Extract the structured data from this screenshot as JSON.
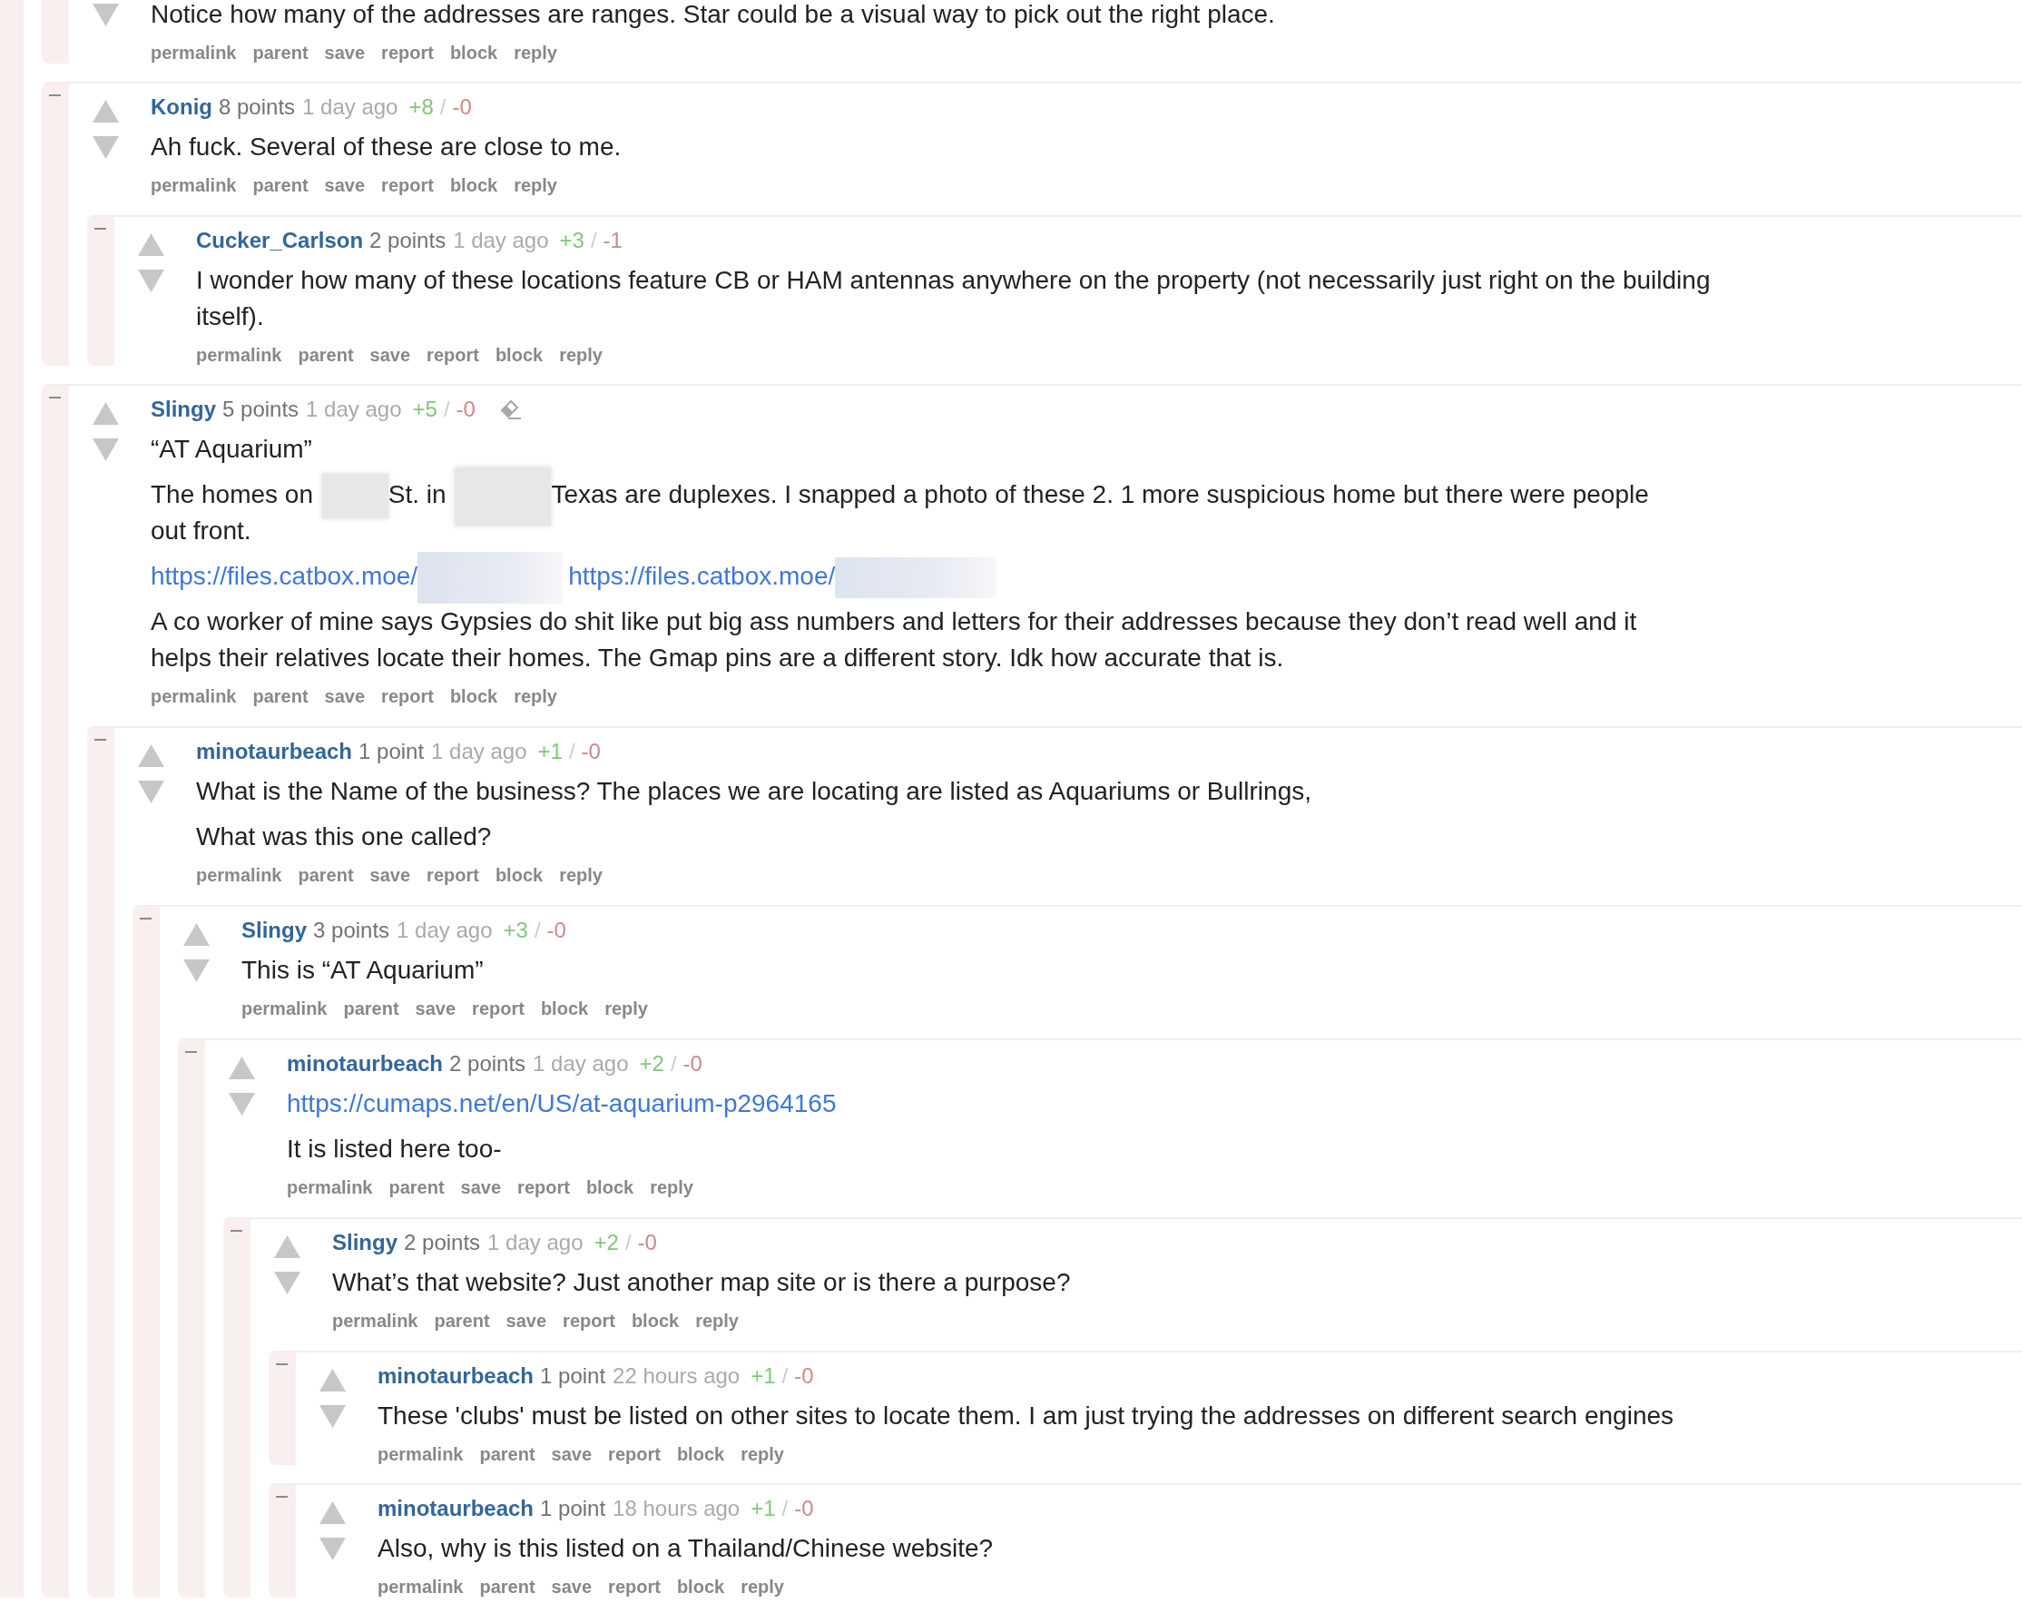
{
  "parent_comment": {
    "children": [
      {
        "body": [
          "Notice how many of the addresses are ranges. Star could be a visual way to pick out the right place."
        ],
        "actions": [
          "permalink",
          "parent",
          "save",
          "report",
          "block",
          "reply"
        ]
      },
      {
        "author": "Konig",
        "points": "8 points",
        "age": "1 day ago",
        "upvotes": "+8",
        "separator": "/",
        "downvotes": "-0",
        "edited": false,
        "body": [
          "Ah fuck. Several of these are close to me."
        ],
        "actions": [
          "permalink",
          "parent",
          "save",
          "report",
          "block",
          "reply"
        ],
        "children": [
          {
            "author": "Cucker_Carlson",
            "points": "2 points",
            "age": "1 day ago",
            "upvotes": "+3",
            "separator": "/",
            "downvotes": "-1",
            "edited": false,
            "body": [
              "I wonder how many of these locations feature CB or HAM antennas anywhere on the property (not necessarily just right on the building itself)."
            ],
            "actions": [
              "permalink",
              "parent",
              "save",
              "report",
              "block",
              "reply"
            ]
          }
        ]
      },
      {
        "author": "Slingy",
        "points": "5 points",
        "age": "1 day ago",
        "upvotes": "+5",
        "separator": "/",
        "downvotes": "-0",
        "edited": true,
        "body": [
          "“AT Aquarium”",
          [
            {
              "kind": "text",
              "text": "The homes on "
            },
            {
              "kind": "redacted"
            },
            {
              "kind": "text",
              "text": "St. in "
            },
            {
              "kind": "redacted"
            },
            {
              "kind": "text",
              "text": "Texas are duplexes. I snapped a photo of these 2. 1 more suspicious home but there were people out front."
            }
          ],
          [
            {
              "kind": "link",
              "text": "https://files.catbox.moe/"
            },
            {
              "kind": "redacted"
            },
            {
              "kind": "link",
              "text": "https://files.catbox.moe/"
            },
            {
              "kind": "redacted"
            }
          ],
          "A co worker of mine says Gypsies do shit like put big ass numbers and letters for their addresses because they don’t read well and it helps their relatives locate their homes. The Gmap pins are a different story. Idk how accurate that is."
        ],
        "actions": [
          "permalink",
          "parent",
          "save",
          "report",
          "block",
          "reply"
        ],
        "children": [
          {
            "author": "minotaurbeach",
            "points": "1 point",
            "age": "1 day ago",
            "upvotes": "+1",
            "separator": "/",
            "downvotes": "-0",
            "edited": false,
            "body": [
              "What is the Name of the business? The places we are locating are listed as Aquariums or Bullrings,",
              "What was this one called?"
            ],
            "actions": [
              "permalink",
              "parent",
              "save",
              "report",
              "block",
              "reply"
            ],
            "children": [
              {
                "author": "Slingy",
                "points": "3 points",
                "age": "1 day ago",
                "upvotes": "+3",
                "separator": "/",
                "downvotes": "-0",
                "edited": false,
                "body": [
                  "This is “AT Aquarium”"
                ],
                "actions": [
                  "permalink",
                  "parent",
                  "save",
                  "report",
                  "block",
                  "reply"
                ],
                "children": [
                  {
                    "author": "minotaurbeach",
                    "points": "2 points",
                    "age": "1 day ago",
                    "upvotes": "+2",
                    "separator": "/",
                    "downvotes": "-0",
                    "edited": false,
                    "body": [
                      [
                        {
                          "kind": "link",
                          "text": "https://cumaps.net/en/US/at-aquarium-p2964165"
                        }
                      ],
                      "It is listed here too-"
                    ],
                    "actions": [
                      "permalink",
                      "parent",
                      "save",
                      "report",
                      "block",
                      "reply"
                    ],
                    "children": [
                      {
                        "author": "Slingy",
                        "points": "2 points",
                        "age": "1 day ago",
                        "upvotes": "+2",
                        "separator": "/",
                        "downvotes": "-0",
                        "edited": false,
                        "body": [
                          "What’s that website? Just another map site or is there a purpose?"
                        ],
                        "actions": [
                          "permalink",
                          "parent",
                          "save",
                          "report",
                          "block",
                          "reply"
                        ],
                        "children": [
                          {
                            "author": "minotaurbeach",
                            "points": "1 point",
                            "age": "22 hours ago",
                            "upvotes": "+1",
                            "separator": "/",
                            "downvotes": "-0",
                            "edited": false,
                            "body": [
                              "These 'clubs' must be listed on other sites to locate them. I am just trying the addresses on different search engines"
                            ],
                            "actions": [
                              "permalink",
                              "parent",
                              "save",
                              "report",
                              "block",
                              "reply"
                            ]
                          },
                          {
                            "author": "minotaurbeach",
                            "points": "1 point",
                            "age": "18 hours ago",
                            "upvotes": "+1",
                            "separator": "/",
                            "downvotes": "-0",
                            "edited": false,
                            "body": [
                              "Also, why is this listed on a Thailand/Chinese website?"
                            ],
                            "actions": [
                              "permalink",
                              "parent",
                              "save",
                              "report",
                              "block",
                              "reply"
                            ]
                          }
                        ]
                      }
                    ]
                  }
                ]
              }
            ]
          }
        ]
      }
    ]
  }
}
